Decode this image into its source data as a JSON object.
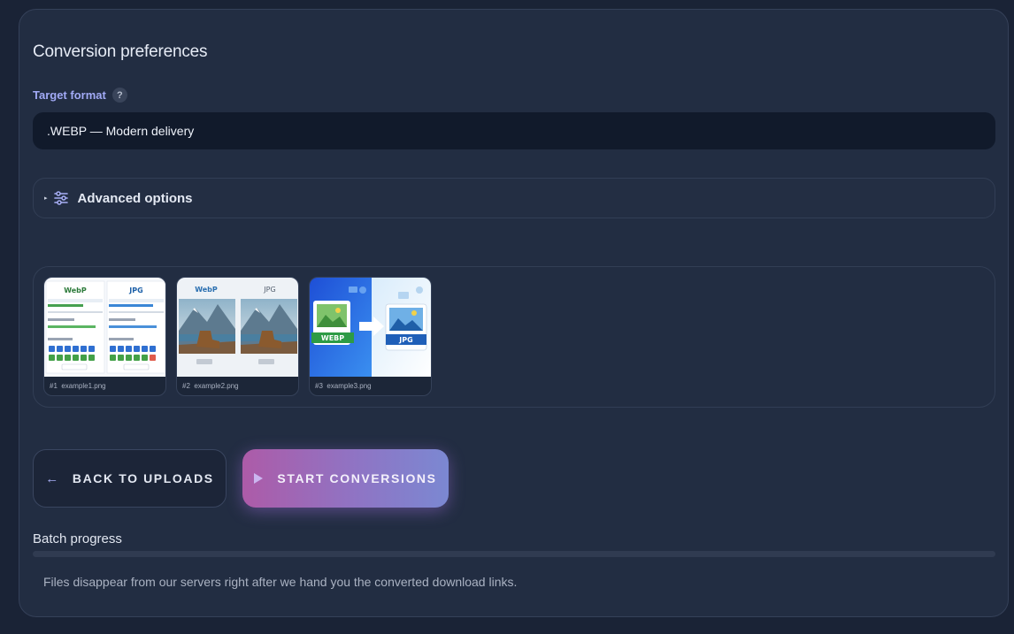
{
  "panel": {
    "heading": "Conversion preferences"
  },
  "target_format": {
    "label": "Target format",
    "help": "?",
    "selected": ".WEBP — Modern delivery"
  },
  "advanced": {
    "caret": "▸",
    "label": "Advanced options"
  },
  "gallery": {
    "items": [
      {
        "index": "#1",
        "filename": "example1.png",
        "left_text": "WebP",
        "right_text": "JPG"
      },
      {
        "index": "#2",
        "filename": "example2.png",
        "left_text": "WebP",
        "right_text": "JPG"
      },
      {
        "index": "#3",
        "filename": "example3.png",
        "left_text": "WEBP",
        "right_text": "JPG"
      }
    ]
  },
  "actions": {
    "back_label": "BACK TO UPLOADS",
    "start_label": "START CONVERSIONS",
    "back_icon": "←"
  },
  "progress": {
    "label": "Batch progress",
    "fraction": 0
  },
  "footnote": "Files disappear from our servers right after we hand you the converted download links.",
  "colors": {
    "accent": "#a2aaf6",
    "panel": "#222d42",
    "background": "#1a2336",
    "start_gradient_a": "#ad5ba8",
    "start_gradient_b": "#7b88d2"
  }
}
